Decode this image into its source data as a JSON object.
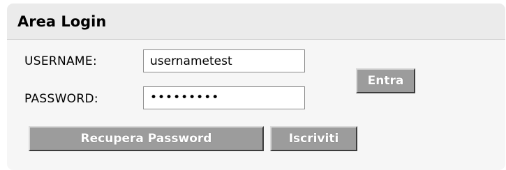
{
  "login": {
    "title": "Area Login",
    "username_label": "USERNAME:",
    "username_value": "usernametest",
    "password_label": "PASSWORD:",
    "password_mask": "•••••••••",
    "submit_label": "Entra",
    "recover_label": "Recupera Password",
    "register_label": "Iscriviti"
  },
  "colors": {
    "panel_header": "#ebebeb",
    "panel_body": "#f6f6f6",
    "button_face": "#9c9c9c",
    "button_text": "#ffffff"
  }
}
